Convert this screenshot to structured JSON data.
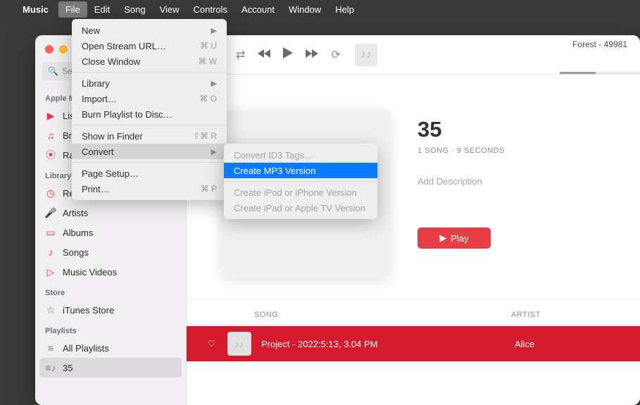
{
  "menubar": {
    "app": "Music",
    "items": [
      "File",
      "Edit",
      "Song",
      "View",
      "Controls",
      "Account",
      "Window",
      "Help"
    ]
  },
  "search": {
    "placeholder": "Search"
  },
  "sidebar": {
    "section_apple": "Apple Music",
    "apple_items": [
      {
        "label": "Listen Now",
        "icon": "play-circle"
      },
      {
        "label": "Browse",
        "icon": "grid"
      },
      {
        "label": "Radio",
        "icon": "radio"
      }
    ],
    "section_library": "Library",
    "library_items": [
      {
        "label": "Recently Added",
        "icon": "clock"
      },
      {
        "label": "Artists",
        "icon": "mic"
      },
      {
        "label": "Albums",
        "icon": "album"
      },
      {
        "label": "Songs",
        "icon": "note"
      },
      {
        "label": "Music Videos",
        "icon": "video"
      }
    ],
    "section_store": "Store",
    "store_items": [
      {
        "label": "iTunes Store",
        "icon": "star"
      }
    ],
    "section_playlists": "Playlists",
    "playlist_items": [
      {
        "label": "All Playlists",
        "icon": "list"
      },
      {
        "label": "35",
        "icon": "playlist"
      }
    ]
  },
  "now_playing": {
    "title": "Forest - 49981"
  },
  "album": {
    "title": "35",
    "meta": "1 SONG · 9 SECONDS",
    "desc_placeholder": "Add Description",
    "play_label": "Play"
  },
  "table": {
    "col_song": "SONG",
    "col_artist": "ARTIST",
    "row": {
      "name": "Project - 2022:5:13, 3.04 PM",
      "artist": "Alice"
    }
  },
  "file_menu": {
    "new": "New",
    "open_stream": "Open Stream URL…",
    "open_stream_sc": "⌘ U",
    "close": "Close Window",
    "close_sc": "⌘ W",
    "library": "Library",
    "import": "Import…",
    "import_sc": "⌘ O",
    "burn": "Burn Playlist to Disc…",
    "show_finder": "Show in Finder",
    "show_finder_sc": "⇧⌘ R",
    "convert": "Convert",
    "page_setup": "Page Setup…",
    "print": "Print…",
    "print_sc": "⌘ P"
  },
  "convert_menu": {
    "id3": "Convert ID3 Tags…",
    "mp3": "Create MP3 Version",
    "ipod": "Create iPod or iPhone Version",
    "ipad": "Create iPad or Apple TV Version"
  }
}
